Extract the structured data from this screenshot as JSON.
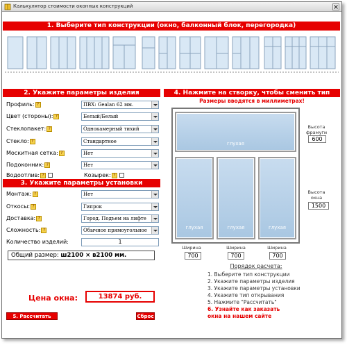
{
  "window": {
    "title": "Калькулятор стоимости оконных конструкций"
  },
  "section1": {
    "title": "1. Выберите тип конструкции (окно, балконный блок, перегородка)"
  },
  "section2": {
    "title": "2. Укажите параметры изделия",
    "fields": [
      {
        "label": "Профиль:",
        "value": "ПВХ: Gealan 62 мм."
      },
      {
        "label": "Цвет (стороны):",
        "value": "Белый/Белый"
      },
      {
        "label": "Стеклопакет:",
        "value": "Однокамерный тихий"
      },
      {
        "label": "Стекло:",
        "value": "Стандартное"
      },
      {
        "label": "Москитная сетка:",
        "value": "Нет"
      },
      {
        "label": "Подоконник:",
        "value": "Нет"
      }
    ],
    "checkboxes": [
      {
        "label": "Водоотлив:"
      },
      {
        "label": "Козырек:"
      }
    ]
  },
  "section3": {
    "title": "3. Укажите параметры установки",
    "fields": [
      {
        "label": "Монтаж:",
        "value": "Нет"
      },
      {
        "label": "Откосы:",
        "value": "Гипрок"
      },
      {
        "label": "Доставка:",
        "value": "Город. Подъем на лифте"
      },
      {
        "label": "Сложность:",
        "value": "Обычное прямоугольное"
      }
    ],
    "quantity_label": "Количество изделий:",
    "quantity_value": "1",
    "total_size_label": "Общий размер:",
    "total_size_value": "ш2100 × в2100 мм."
  },
  "price": {
    "label": "Цена окна:",
    "value": "13874 руб."
  },
  "buttons": {
    "calculate": "5. Рассчитать",
    "reset": "Сброс"
  },
  "section4": {
    "title": "4. Нажмите на створку, чтобы сменить тип",
    "subtitle": "Размеры вводятся в миллиметрах!",
    "sash_label": "глухая",
    "transom_height_label_1": "Высота",
    "transom_height_label_2": "фрамуги",
    "transom_height_value": "600",
    "window_height_label_1": "Высота",
    "window_height_label_2": "окна",
    "window_height_value": "1500",
    "width_label": "Ширина",
    "widths": [
      "700",
      "700",
      "700"
    ]
  },
  "steps": {
    "header": "Порядок расчета:",
    "items": [
      "1. Выберите тип конструкции",
      "2. Укажите параметры изделия",
      "3. Укажите параметры установки",
      "4. Укажите тип открывания",
      "5. Нажмите \"Рассчитать\""
    ],
    "highlight_1": "6. Узнайте как заказать",
    "highlight_2": "окна на нашем сайте"
  },
  "colors": {
    "accent": "#e60000",
    "glass": "#b8d2ea"
  }
}
